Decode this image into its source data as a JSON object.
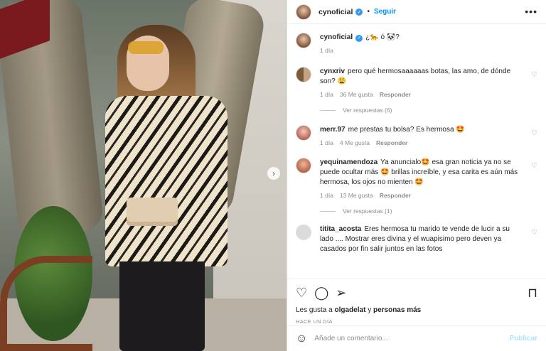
{
  "header": {
    "username": "cynoficial",
    "verified_icon": "verified-badge-icon",
    "separator": "•",
    "follow_label": "Seguir",
    "more_label": "•••"
  },
  "caption": {
    "username": "cynoficial",
    "text": "¿🐆 ó 🐼?",
    "time": "1 día"
  },
  "comments": [
    {
      "username": "cynxriv",
      "text": "pero qué hermosaaaaaas botas, las amo, de dónde son? 😩",
      "time": "1 día",
      "likes": "36 Me gusta",
      "reply": "Responder",
      "view_replies": "Ver respuestas (6)"
    },
    {
      "username": "merr.97",
      "text": "me prestas tu bolsa? Es hermosa 🤩",
      "time": "1 día",
      "likes": "4 Me gusta",
      "reply": "Responder"
    },
    {
      "username": "yequinamendoza",
      "text": "Ya anuncialo🤩 esa gran noticia ya no se puede ocultar más 🤩 brillas increíble, y esa carita es aún más hermosa, los ojos no mienten 🤩",
      "time": "1 día",
      "likes": "13 Me gusta",
      "reply": "Responder",
      "view_replies": "Ver respuestas (1)"
    },
    {
      "username": "titita_acosta",
      "text": "Eres hermosa tu marido te vende de lucir a su lado .... Mostrar eres divina y el wuapisimo pero deven ya casados por fin salir juntos en las fotos"
    }
  ],
  "actions": {
    "like_icon": "heart-icon",
    "comment_icon": "comment-icon",
    "share_icon": "send-icon",
    "save_icon": "bookmark-icon",
    "likes_prefix": "Les gusta a",
    "likes_user": "olgadelat",
    "likes_joiner": "y",
    "likes_rest": "personas más",
    "when": "HACE UN DÍA"
  },
  "composer": {
    "emoji_icon": "emoji-icon",
    "placeholder": "Añade un comentario...",
    "publish_label": "Publicar"
  },
  "colors": {
    "accent": "#0095f6",
    "publish_disabled": "#b2dffc",
    "muted": "#8e8e8e"
  }
}
